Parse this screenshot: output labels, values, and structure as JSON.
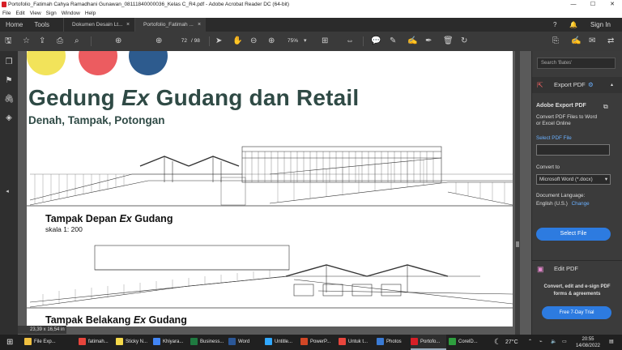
{
  "window": {
    "title": "Portofolio_Fatimah Cahya Ramadhani Gunawan_08111840000036_Kelas C_R4.pdf - Adobe Acrobat Reader DC (64-bit)",
    "minimize": "—",
    "maximize": "☐",
    "close": "✕"
  },
  "menu": [
    "File",
    "Edit",
    "View",
    "Sign",
    "Window",
    "Help"
  ],
  "tabs": {
    "home": "Home",
    "tools": "Tools",
    "doc1": "Dokumen Desain Lt...",
    "doc2": "Portofolio_Fatimah ...",
    "close": "×",
    "sign_in": "Sign In"
  },
  "toolbar": {
    "page_current": "72",
    "page_total": "/ 98",
    "zoom": "75%"
  },
  "document": {
    "title_pre": "Gedung ",
    "title_em": "Ex",
    "title_post": " Gudang dan Retail",
    "subtitle": "Denah, Tampak, Potongan",
    "caption1_pre": "Tampak Depan ",
    "caption1_em": "Ex",
    "caption1_post": " Gudang",
    "scale1": "skala 1: 200",
    "caption2_pre": "Tampak Belakang ",
    "caption2_em": "Ex",
    "caption2_post": " Gudang",
    "colors": [
      "#f2e35a",
      "#ec5c60",
      "#2d5b8e"
    ]
  },
  "right_panel": {
    "search_placeholder": "Search 'Bates'",
    "export_title": "Export PDF",
    "adobe_export": "Adobe Export PDF",
    "desc_line1": "Convert PDF Files to Word",
    "desc_line2": "or Excel Online",
    "select_pdf": "Select PDF File",
    "convert_to": "Convert to",
    "format": "Microsoft Word (*.docx)",
    "doc_language": "Document Language:",
    "language": "English (U.S.)",
    "change": "Change",
    "select_file_btn": "Select File",
    "edit_pdf": "Edit PDF",
    "promo_line1": "Convert, edit and e-sign PDF",
    "promo_line2": "forms & agreements",
    "trial_btn": "Free 7-Day Trial"
  },
  "status": {
    "dimensions": "23,39 x 16,54 in"
  },
  "taskbar": {
    "items": [
      {
        "label": "File Exp...",
        "color": "#f0c040"
      },
      {
        "label": "fatimah...",
        "color": "#e8453c"
      },
      {
        "label": "Sticky N...",
        "color": "#f5d94a"
      },
      {
        "label": "Khiyara...",
        "color": "#4285f4"
      },
      {
        "label": "Business...",
        "color": "#1f7a40"
      },
      {
        "label": "Word",
        "color": "#2b5797"
      },
      {
        "label": "Untitle...",
        "color": "#31a8ff"
      },
      {
        "label": "PowerP...",
        "color": "#d24726"
      },
      {
        "label": "Untuk t...",
        "color": "#e8453c"
      },
      {
        "label": "Photos",
        "color": "#3a7bd5"
      },
      {
        "label": "Portofo...",
        "color": "#d71f27"
      },
      {
        "label": "CorelD...",
        "color": "#2e9e3e"
      }
    ],
    "temperature": "27°C",
    "time": "20:55",
    "date": "14/08/2022"
  }
}
